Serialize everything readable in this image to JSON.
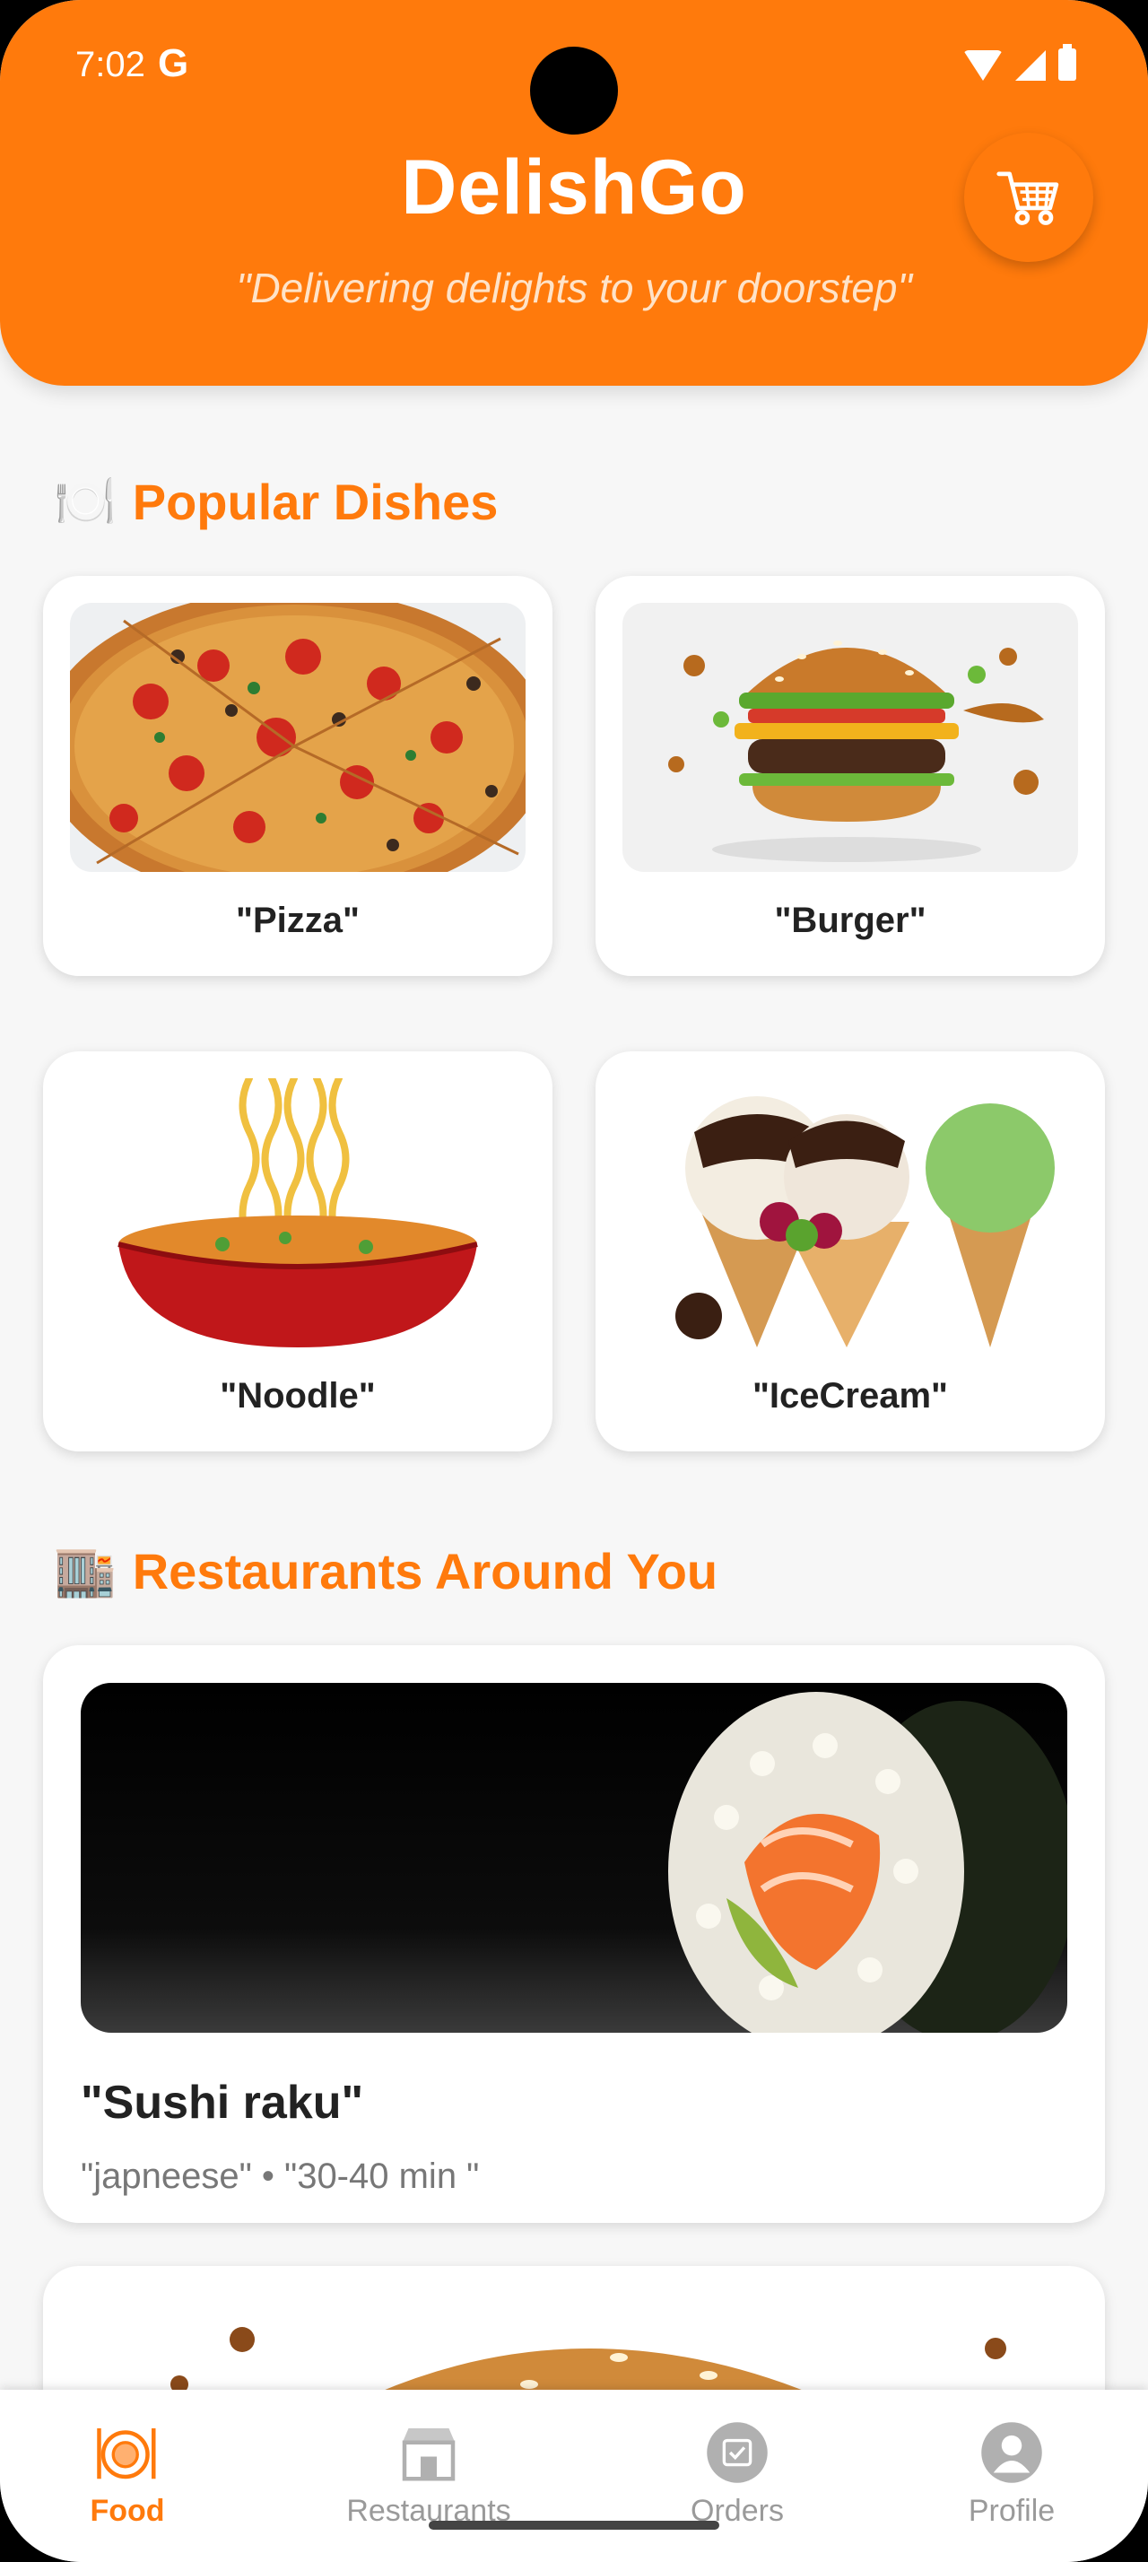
{
  "status_bar": {
    "time": "7:02",
    "google_glyph": "G"
  },
  "header": {
    "title": "DelishGo",
    "tagline": "\"Delivering delights to your doorstep\"",
    "cart_icon": "shopping-cart-icon"
  },
  "popular": {
    "emoji": "🍽️",
    "title": "Popular Dishes",
    "dishes": [
      {
        "name": "\"Pizza\""
      },
      {
        "name": "\"Burger\""
      },
      {
        "name": "\"Noodle\""
      },
      {
        "name": "\"IceCream\""
      }
    ]
  },
  "restaurants": {
    "emoji": "🏬",
    "title": "Restaurants Around You",
    "items": [
      {
        "name": "\"Sushi raku\"",
        "meta": "\"japneese\" • \"30-40 min \""
      }
    ]
  },
  "bottom_nav": {
    "items": [
      {
        "label": "Food",
        "icon": "food-plate-icon"
      },
      {
        "label": "Restaurants",
        "icon": "storefront-icon"
      },
      {
        "label": "Orders",
        "icon": "orders-icon"
      },
      {
        "label": "Profile",
        "icon": "profile-icon"
      }
    ]
  },
  "colors": {
    "brand": "#ff7a0c",
    "background": "#f7f7f7"
  }
}
